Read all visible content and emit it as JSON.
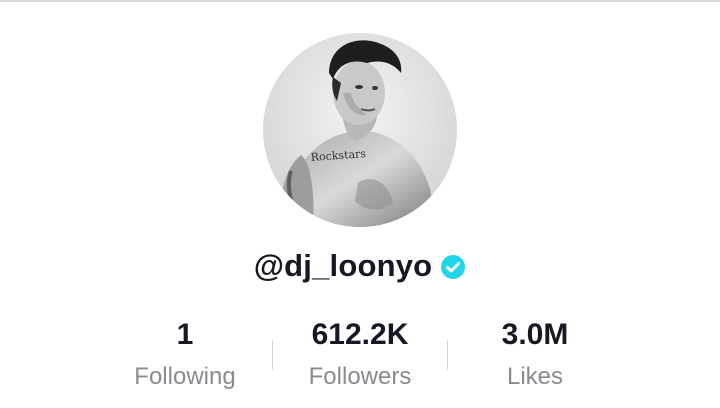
{
  "profile": {
    "username": "@dj_loonyo",
    "verified": true,
    "verified_icon": "verified-check-icon",
    "avatar_icon": "profile-photo"
  },
  "stats": {
    "following": {
      "value": "1",
      "label": "Following"
    },
    "followers": {
      "value": "612.2K",
      "label": "Followers"
    },
    "likes": {
      "value": "3.0M",
      "label": "Likes"
    }
  },
  "colors": {
    "primary_text": "#161823",
    "secondary_text": "#8a8b91",
    "verified_blue": "#20d5ec",
    "divider": "#d6d6d8"
  }
}
